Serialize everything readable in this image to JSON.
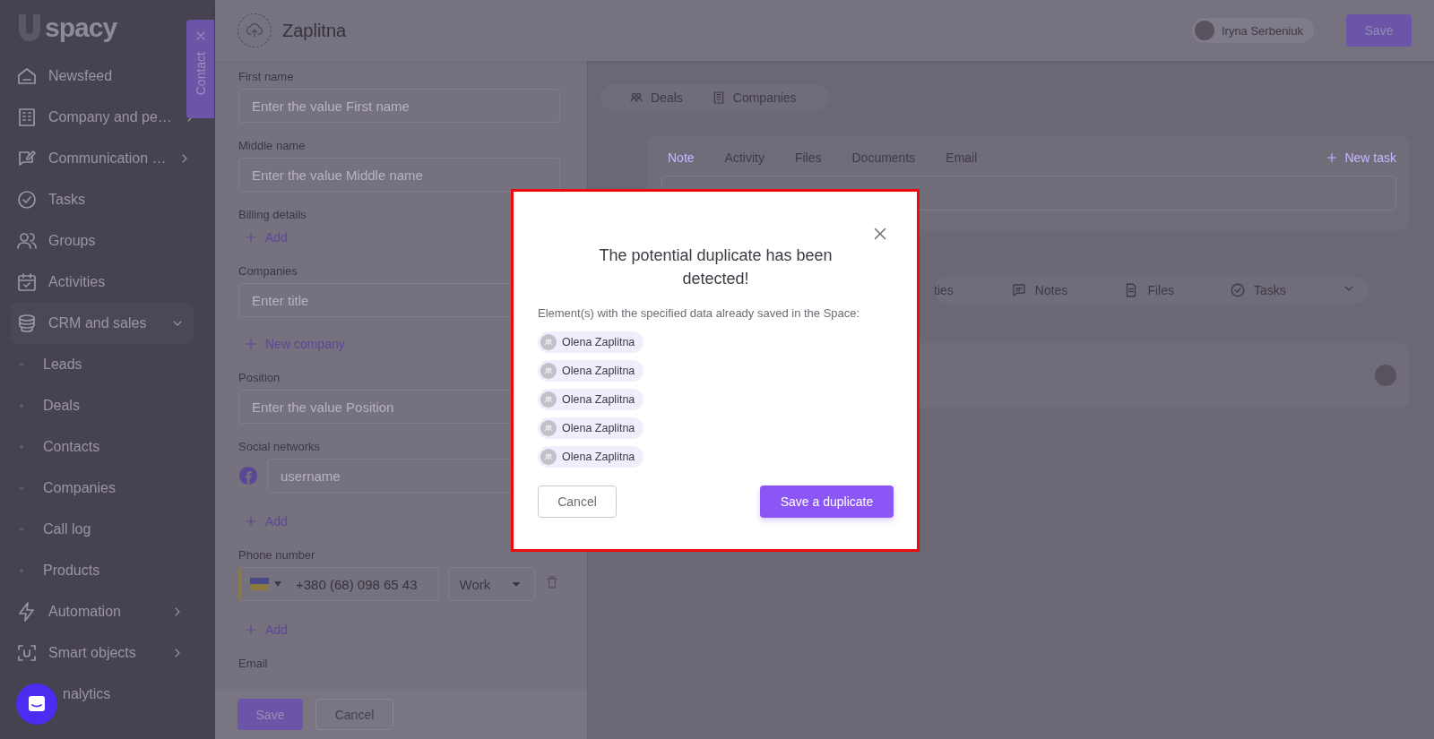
{
  "logo": {
    "text": "spacy"
  },
  "sidebar": {
    "items": [
      {
        "label": "Newsfeed",
        "kind": "item"
      },
      {
        "label": "Company and pe…",
        "kind": "group",
        "expanded": false
      },
      {
        "label": "Communication …",
        "kind": "group",
        "expanded": false
      },
      {
        "label": "Tasks",
        "kind": "item"
      },
      {
        "label": "Groups",
        "kind": "item"
      },
      {
        "label": "Activities",
        "kind": "item"
      },
      {
        "label": "CRM and sales",
        "kind": "group",
        "expanded": true,
        "children": [
          {
            "label": "Leads"
          },
          {
            "label": "Deals"
          },
          {
            "label": "Contacts"
          },
          {
            "label": "Companies"
          },
          {
            "label": "Call log"
          },
          {
            "label": "Products"
          }
        ]
      },
      {
        "label": "Automation",
        "kind": "group",
        "expanded": false
      },
      {
        "label": "Smart objects",
        "kind": "group",
        "expanded": false
      },
      {
        "label": "nalytics",
        "kind": "cut"
      }
    ]
  },
  "side_tab": {
    "label": "Contact"
  },
  "header": {
    "title": "Zaplitna",
    "user": "Iryna Serbeniuk",
    "save": "Save"
  },
  "form": {
    "items": [
      {
        "kind": "label",
        "text": "First name"
      },
      {
        "kind": "input",
        "placeholder": "Enter the value First name"
      },
      {
        "kind": "label",
        "text": "Middle name"
      },
      {
        "kind": "input",
        "placeholder": "Enter the value Middle name"
      },
      {
        "kind": "label",
        "text": "Billing details"
      },
      {
        "kind": "link",
        "text": "Add"
      },
      {
        "kind": "label",
        "text": "Companies"
      },
      {
        "kind": "input",
        "placeholder": "Enter title"
      },
      {
        "kind": "link",
        "text": "New company"
      },
      {
        "kind": "label",
        "text": "Position"
      },
      {
        "kind": "input",
        "placeholder": "Enter the value Position"
      },
      {
        "kind": "label",
        "text": "Social networks"
      },
      {
        "kind": "social",
        "placeholder": "username"
      },
      {
        "kind": "link",
        "text": "Add"
      },
      {
        "kind": "label",
        "text": "Phone number"
      },
      {
        "kind": "phone",
        "value": "+380 (68) 098 65 43",
        "type": "Work"
      },
      {
        "kind": "link",
        "text": "Add"
      },
      {
        "kind": "label",
        "text": "Email"
      }
    ]
  },
  "footer": {
    "save": "Save",
    "cancel": "Cancel"
  },
  "relation_tabs": [
    "Deals",
    "Companies"
  ],
  "composer": {
    "tabs": [
      {
        "label": "Note",
        "selected": true
      },
      {
        "label": "Activity",
        "selected": false
      },
      {
        "label": "Files",
        "selected": false
      },
      {
        "label": "Documents",
        "selected": false
      },
      {
        "label": "Email",
        "selected": false
      }
    ],
    "new_task": "New task"
  },
  "feed_tabs": [
    "ties",
    "Notes",
    "Files",
    "Tasks"
  ],
  "modal": {
    "title": "The potential duplicate has been detected!",
    "message": "Element(s) with the specified data already saved in the Space:",
    "duplicates": [
      "Olena Zaplitna",
      "Olena Zaplitna",
      "Olena Zaplitna",
      "Olena Zaplitna",
      "Olena Zaplitna"
    ],
    "cancel": "Cancel",
    "confirm": "Save a duplicate"
  }
}
